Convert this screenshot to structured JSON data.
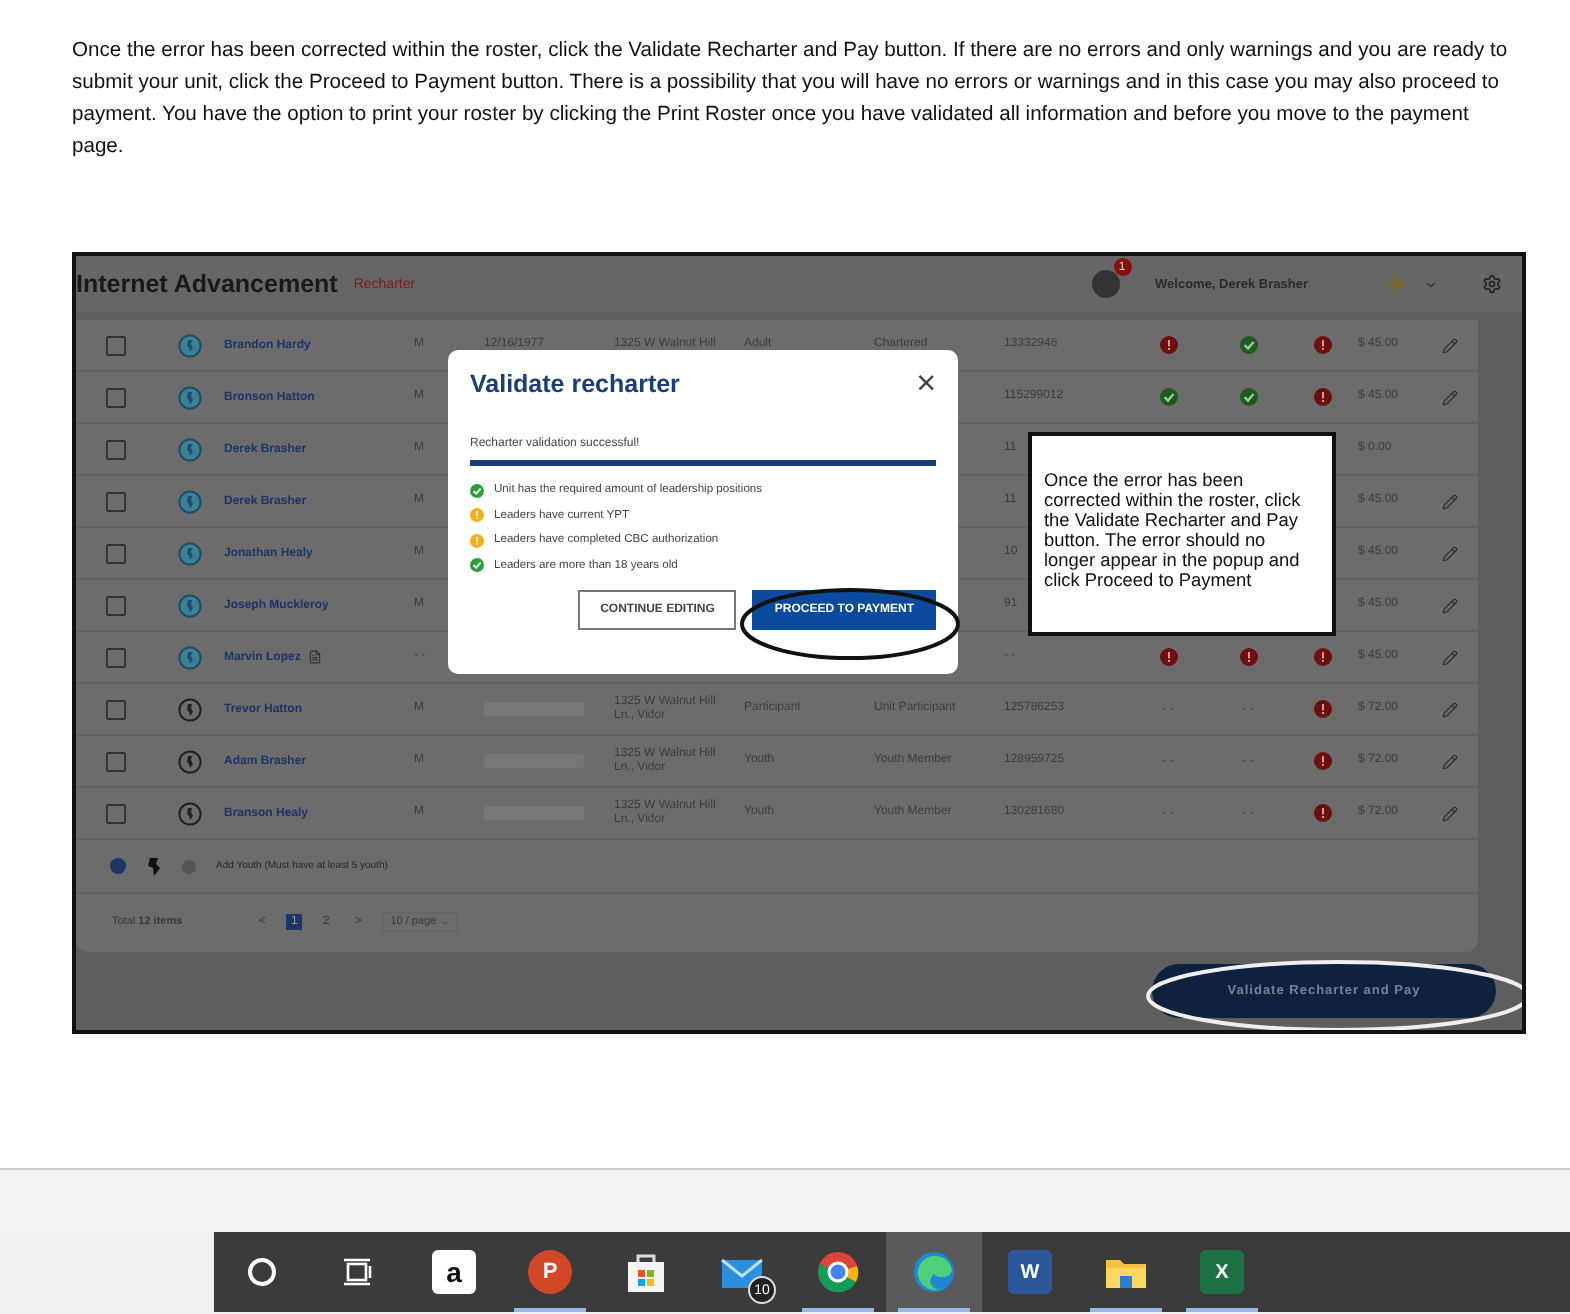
{
  "document": {
    "paragraph": "Once the error has been corrected within the roster, click the Validate Recharter and Pay button.  If there are no errors and only warnings and you are ready to submit your unit, click the Proceed to Payment button. There is a possibility that you will have no errors or warnings and in this case you may also proceed to payment. You have the option to print your roster by clicking the Print Roster once you have validated all information and before you move to the payment page."
  },
  "app": {
    "title": "Internet Advancement",
    "section": "Recharter",
    "notifications": "1",
    "welcome": "Welcome, Derek Brasher",
    "rows": [
      {
        "checked": false,
        "kind": "adult",
        "name": "Brandon Hardy",
        "gender": "M",
        "dob": "12/16/1977",
        "address": "1325 W Walnut Hill",
        "type": "Adult",
        "position": "Chartered",
        "member_id": "13332946",
        "statuses": [
          {
            "kind": "error"
          },
          {
            "kind": "ok"
          },
          {
            "kind": "error"
          }
        ],
        "fee": "$ 45.00",
        "editable": true
      },
      {
        "checked": false,
        "kind": "adult",
        "name": "Bronson Hatton",
        "gender": "M",
        "member_id": "115299012",
        "statuses": [
          {
            "kind": "ok"
          },
          {
            "kind": "ok"
          },
          {
            "kind": "error"
          }
        ],
        "fee": "$ 45.00",
        "editable": true
      },
      {
        "checked": false,
        "kind": "adult",
        "name": "Derek Brasher",
        "gender": "M",
        "member_id": "11",
        "fee": "$ 0.00",
        "editable": false
      },
      {
        "checked": false,
        "kind": "adult",
        "name": "Derek Brasher",
        "gender": "M",
        "member_id": "11",
        "fee": "$ 45.00",
        "editable": true
      },
      {
        "checked": false,
        "kind": "adult",
        "name": "Jonathan Healy",
        "gender": "M",
        "member_id": "10",
        "fee": "$ 45.00",
        "editable": true
      },
      {
        "checked": false,
        "kind": "adult",
        "name": "Joseph Muckleroy",
        "gender": "M",
        "member_id": "91",
        "fee": "$ 45.00",
        "editable": true
      },
      {
        "checked": false,
        "kind": "adult",
        "name": "Marvin Lopez",
        "has_document": true,
        "gender": "- -",
        "member_id": "- -",
        "statuses": [
          {
            "kind": "error"
          },
          {
            "kind": "error"
          },
          {
            "kind": "error"
          }
        ],
        "fee": "$ 45.00",
        "editable": true
      },
      {
        "checked": false,
        "kind": "youth",
        "name": "Trevor Hatton",
        "gender": "M",
        "dob_blurred": true,
        "address": "1325 W Walnut Hill Ln., Vidor",
        "type": "Participant",
        "position": "Unit Participant",
        "member_id": "125786253",
        "statuses": [
          {
            "kind": "text",
            "text": "- -"
          },
          {
            "kind": "text",
            "text": "- -"
          },
          {
            "kind": "error"
          }
        ],
        "fee": "$ 72.00",
        "editable": true
      },
      {
        "checked": false,
        "kind": "youth",
        "name": "Adam Brasher",
        "gender": "M",
        "dob_blurred": true,
        "address": "1325 W Walnut Hill Ln., Vidor",
        "type": "Youth",
        "position": "Youth Member",
        "member_id": "128959725",
        "statuses": [
          {
            "kind": "text",
            "text": "- -"
          },
          {
            "kind": "text",
            "text": "- -"
          },
          {
            "kind": "error"
          }
        ],
        "fee": "$ 72.00",
        "editable": true
      },
      {
        "checked": false,
        "kind": "youth",
        "name": "Branson Healy",
        "gender": "M",
        "dob_blurred": true,
        "address": "1325 W Walnut Hill Ln., Vidor",
        "type": "Youth",
        "position": "Youth Member",
        "member_id": "130281680",
        "statuses": [
          {
            "kind": "text",
            "text": "- -"
          },
          {
            "kind": "text",
            "text": "- -"
          },
          {
            "kind": "error"
          }
        ],
        "fee": "$ 72.00",
        "editable": true
      }
    ],
    "add_row": {
      "label": "Add Youth (Must have at least 5 youth)"
    },
    "pagination": {
      "total": "Total **12 items**",
      "prev": "<",
      "pages": [
        {
          "label": "1",
          "selected": true
        },
        {
          "label": "2",
          "selected": false
        }
      ],
      "next": ">",
      "page_size": "10 / page"
    },
    "primary_button": "Validate Recharter and Pay"
  },
  "modal": {
    "title": "Validate recharter",
    "close": "×",
    "message": "Recharter validation successful!",
    "level": 1,
    "checks": [
      {
        "kind": "ok",
        "text": "Unit has the required amount of leadership positions"
      },
      {
        "kind": "warning",
        "text": "Leaders have current YPT"
      },
      {
        "kind": "warning",
        "text": "Leaders have completed CBC authorization"
      },
      {
        "kind": "ok",
        "text": "Leaders are more than 18 years old"
      }
    ],
    "buttons": [
      {
        "kind": "secondary",
        "label": "CONTINUE EDITING"
      },
      {
        "kind": "primary",
        "label": "PROCEED TO PAYMENT"
      }
    ]
  },
  "callout": {
    "text": "Once the error has been corrected within the roster, click the Validate Recharter and Pay button. The error should no longer appear in the popup and click Proceed to Payment"
  },
  "taskbar": {
    "items": [
      {
        "kind": "search",
        "running": false,
        "selected": false
      },
      {
        "kind": "taskview",
        "running": false,
        "selected": false
      },
      {
        "kind": "amazon",
        "glyph": "a",
        "running": false,
        "selected": false
      },
      {
        "kind": "powerpoint",
        "glyph": "P",
        "running": true,
        "selected": false
      },
      {
        "kind": "store",
        "running": false,
        "selected": false
      },
      {
        "kind": "mail",
        "badge": "10",
        "running": false,
        "selected": false
      },
      {
        "kind": "chrome",
        "running": true,
        "selected": false
      },
      {
        "kind": "edge",
        "running": true,
        "selected": true
      },
      {
        "kind": "word",
        "glyph": "W",
        "running": false,
        "selected": false
      },
      {
        "kind": "explorer",
        "running": true,
        "selected": false
      },
      {
        "kind": "excel",
        "glyph": "X",
        "running": true,
        "selected": false
      }
    ]
  }
}
